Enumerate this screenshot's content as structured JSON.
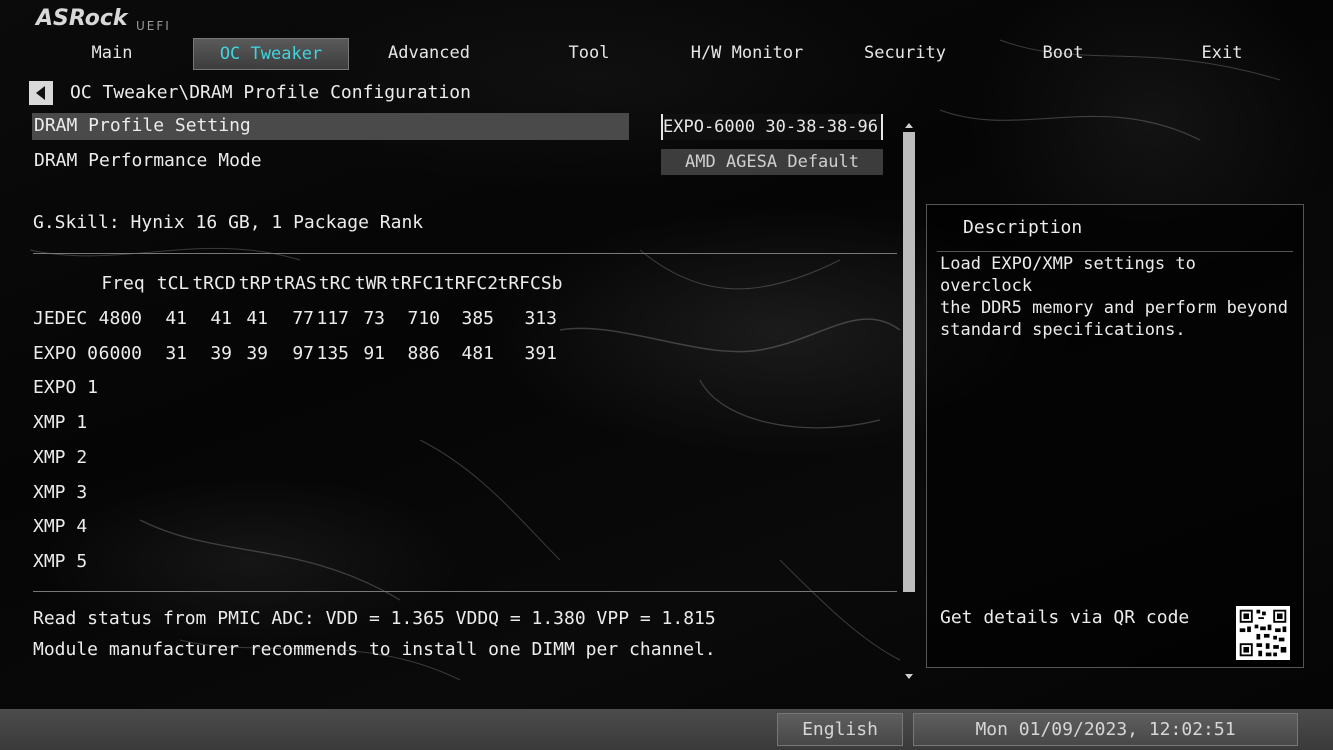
{
  "brand": {
    "logo": "ASRock",
    "sub": "UEFI"
  },
  "nav": {
    "tabs": [
      {
        "label": "Main"
      },
      {
        "label": "OC Tweaker",
        "active": true
      },
      {
        "label": "Advanced"
      },
      {
        "label": "Tool"
      },
      {
        "label": "H/W Monitor"
      },
      {
        "label": "Security"
      },
      {
        "label": "Boot"
      },
      {
        "label": "Exit"
      }
    ]
  },
  "breadcrumb": "OC Tweaker\\DRAM Profile Configuration",
  "settings": {
    "profile_label": "DRAM Profile Setting",
    "profile_value": "EXPO-6000 30-38-38-96...",
    "perf_label": "DRAM Performance Mode",
    "perf_value": "AMD AGESA Default"
  },
  "module_info": "G.Skill: Hynix 16 GB, 1 Package Rank",
  "timings": {
    "headers": [
      "Freq",
      "tCL",
      "tRCD",
      "tRP",
      "tRAS",
      "tRC",
      "tWR",
      "tRFC1",
      "tRFC2",
      "tRFCSb"
    ],
    "rows": [
      {
        "name": "JEDEC",
        "values": [
          "4800",
          "41",
          "41",
          "41",
          "77",
          "117",
          "73",
          "710",
          "385",
          "313"
        ]
      },
      {
        "name": "EXPO 0",
        "values": [
          "6000",
          "31",
          "39",
          "39",
          "97",
          "135",
          "91",
          "886",
          "481",
          "391"
        ]
      },
      {
        "name": "EXPO 1",
        "values": []
      },
      {
        "name": "XMP 1",
        "values": []
      },
      {
        "name": "XMP 2",
        "values": []
      },
      {
        "name": "XMP 3",
        "values": []
      },
      {
        "name": "XMP 4",
        "values": []
      },
      {
        "name": "XMP 5",
        "values": []
      }
    ]
  },
  "status": {
    "pmic": "Read status from PMIC ADC: VDD = 1.365 VDDQ = 1.380 VPP = 1.815",
    "recommend": "Module manufacturer recommends to install one DIMM per channel."
  },
  "description": {
    "title": "Description",
    "text": "Load EXPO/XMP settings to overclock\nthe DDR5 memory and perform beyond\nstandard specifications.",
    "qr_label": "Get details via QR code"
  },
  "footer": {
    "language": "English",
    "datetime": "Mon 01/09/2023, 12:02:51"
  },
  "colors": {
    "accent": "#3fd4e0",
    "highlight": "#4a4a4a"
  }
}
